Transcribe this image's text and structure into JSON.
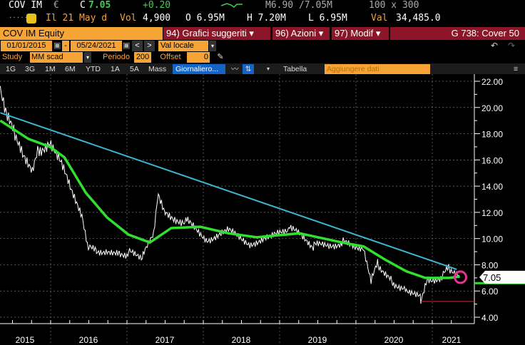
{
  "quote": {
    "ticker": "COV IM",
    "currency": "€",
    "last_prefix": "C",
    "last": "7.05",
    "change": "+0.20",
    "bid_ask": "M6.90 /7.05M",
    "size": "100 x 300",
    "dots": ".....",
    "date": "Il 21 May d",
    "vol_label": "Vol",
    "vol": "4,900",
    "open": "O 6.95M",
    "high": "H 7.20M",
    "low": "L 6.95M",
    "val_label": "Val",
    "val": "34,485.0"
  },
  "bar": {
    "security": "COV IM Equity",
    "suggested": "94) Grafici suggeriti",
    "actions": "96) Azioni",
    "modify": "97) Modif",
    "title": "G 738: Cover 50"
  },
  "range": {
    "start": "01/01/2015",
    "dash": "-",
    "end": "05/24/2021",
    "currency_mode": "Val locale"
  },
  "study": {
    "label": "Study",
    "type": "MM scad",
    "period_label": "Periodo",
    "period": "200",
    "offset_label": "Offset",
    "offset": "0"
  },
  "toolbar": {
    "periods": [
      "1G",
      "3G",
      "1M",
      "6M",
      "YTD",
      "1A",
      "5A",
      "Mass"
    ],
    "frequency": "Giornaliero...",
    "table": "Tabella",
    "add_data": "Aggiungere dati"
  },
  "colors": {
    "price": "#ffffff",
    "ma": "#2fe02f",
    "trend": "#3bb8d0",
    "support": "#c0232b",
    "highlight": "#e8338f"
  },
  "chart_data": {
    "type": "line",
    "ylim": [
      4,
      22
    ],
    "yticks": [
      "22.00",
      "20.00",
      "18.00",
      "16.00",
      "14.00",
      "12.00",
      "10.00",
      "8.00",
      "6.00",
      "4.00"
    ],
    "xticks": [
      "2015",
      "2016",
      "2017",
      "2018",
      "2019",
      "2020",
      "2021"
    ],
    "last_label": "7.05",
    "series": [
      {
        "name": "Price",
        "x": [
          2015.34,
          2015.42,
          2015.52,
          2015.62,
          2015.76,
          2015.85,
          2015.99,
          2016.13,
          2016.27,
          2016.41,
          2016.5,
          2016.6,
          2016.74,
          2016.9,
          2017.02,
          2017.21,
          2017.35,
          2017.41,
          2017.5,
          2017.77,
          2018.05,
          2018.33,
          2018.61,
          2018.89,
          2019.12,
          2019.45,
          2019.82,
          2020.1,
          2020.2,
          2020.29,
          2020.48,
          2020.66,
          2020.85,
          2020.93,
          2021.13,
          2021.22,
          2021.36
        ],
        "y": [
          20.9,
          19.2,
          17.9,
          17.0,
          15.1,
          16.8,
          17.6,
          15.7,
          13.5,
          11.9,
          9.2,
          9.0,
          9.2,
          8.8,
          8.9,
          8.6,
          10.3,
          13.6,
          11.9,
          11.3,
          10.0,
          10.5,
          9.7,
          10.0,
          10.8,
          9.4,
          9.7,
          9.4,
          6.7,
          8.1,
          6.7,
          6.2,
          5.4,
          7.0,
          7.0,
          7.8,
          7.05
        ]
      },
      {
        "name": "MM 200",
        "x": [
          2015.34,
          2015.71,
          2015.99,
          2016.18,
          2016.46,
          2016.74,
          2017.02,
          2017.3,
          2017.58,
          2017.96,
          2018.33,
          2018.7,
          2019.26,
          2019.82,
          2020.1,
          2020.38,
          2020.66,
          2020.91,
          2021.22,
          2021.36
        ],
        "y": [
          19.0,
          17.6,
          17.0,
          16.2,
          13.5,
          11.6,
          10.3,
          9.7,
          10.8,
          10.9,
          10.4,
          10.1,
          10.4,
          9.7,
          9.4,
          8.4,
          7.5,
          7.0,
          7.0,
          7.1
        ]
      },
      {
        "name": "Trend",
        "x": [
          2015.34,
          2021.32
        ],
        "y": [
          19.6,
          7.65
        ]
      },
      {
        "name": "Support",
        "x": [
          2020.85,
          2021.6
        ],
        "y": [
          5.2,
          5.2
        ]
      }
    ]
  }
}
